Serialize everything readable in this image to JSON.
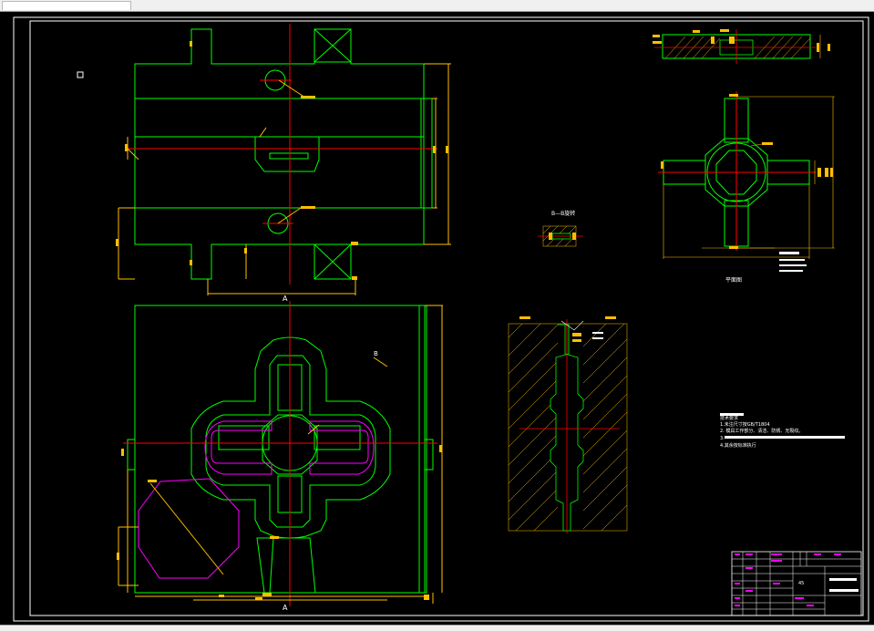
{
  "drawing": {
    "section_label": "B—B旋转",
    "view_label": "平面图",
    "view_marker_a_top": "A",
    "view_marker_a_bottom": "A",
    "note_b": "B",
    "notes": {
      "line1": "技术要求",
      "line2": "1.未注尺寸按GB/T1804",
      "line3": "2. 模具工作部分、清洁、防锈、无裂纹。",
      "line4": "3.",
      "line5": "4.其余按标准执行"
    },
    "title_block": {
      "scale_text": "45"
    },
    "colors": {
      "background": "#000000",
      "outline": "#00ff00",
      "centerline": "#ff0000",
      "dimension": "#ffbf00",
      "cavity": "#ff00ff",
      "border": "#ffffff"
    }
  }
}
